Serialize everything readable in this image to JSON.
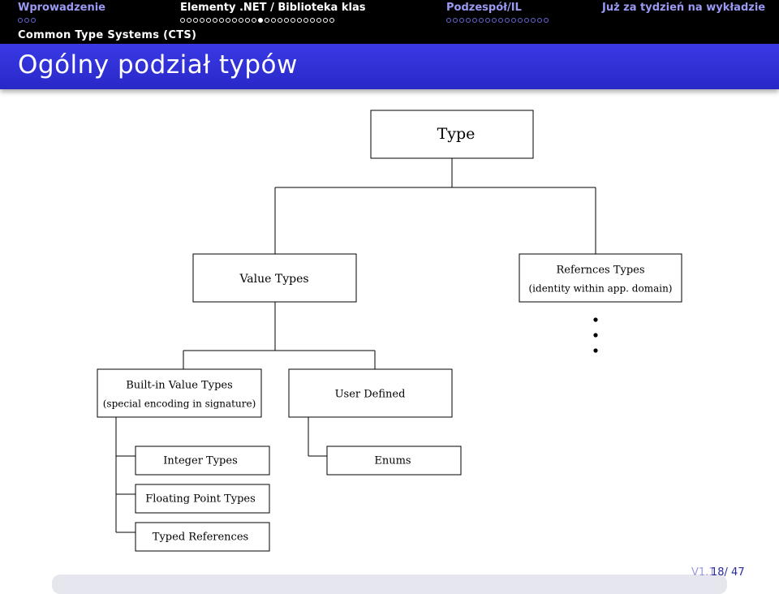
{
  "navigation": {
    "sections": [
      {
        "label": "Wprowadzenie",
        "dots": 3,
        "filled": 0,
        "color": "#9a9af5"
      },
      {
        "label": "Elementy .NET / Biblioteka klas",
        "dots": 24,
        "filled": 12,
        "color": "#ffffff"
      },
      {
        "label": "Podzespół/IL",
        "dots": 16,
        "filled": 0,
        "color": "#9a9af5"
      },
      {
        "label": "Już za tydzień na wykładzie",
        "dots": 0,
        "filled": 0,
        "color": "#9a9af5"
      }
    ],
    "current_dot": 13,
    "subsection": "Common Type Systems (CTS)"
  },
  "frame": {
    "title": "Ogólny podział typów"
  },
  "diagram": {
    "nodes": {
      "type": {
        "lines": [
          "Type"
        ]
      },
      "value_types": {
        "lines": [
          "Value Types"
        ]
      },
      "reference_types": {
        "lines": [
          "Refernces Types",
          "(identity within app. domain)"
        ]
      },
      "builtin_value_types": {
        "lines": [
          "Built-in Value Types",
          "(special encoding in signature)"
        ]
      },
      "user_defined": {
        "lines": [
          "User Defined"
        ]
      },
      "integer_types": {
        "lines": [
          "Integer Types"
        ]
      },
      "floating_point_types": {
        "lines": [
          "Floating Point Types"
        ]
      },
      "typed_references": {
        "lines": [
          "Typed References"
        ]
      },
      "enums": {
        "lines": [
          "Enums"
        ]
      }
    }
  },
  "footer": {
    "version": "V1.1",
    "page": "18/ 47"
  },
  "colors": {
    "title_band": "#2f2fd8",
    "header_bg": "#000000",
    "active_section": "#ffffff",
    "inactive_section": "#9a9af5"
  }
}
